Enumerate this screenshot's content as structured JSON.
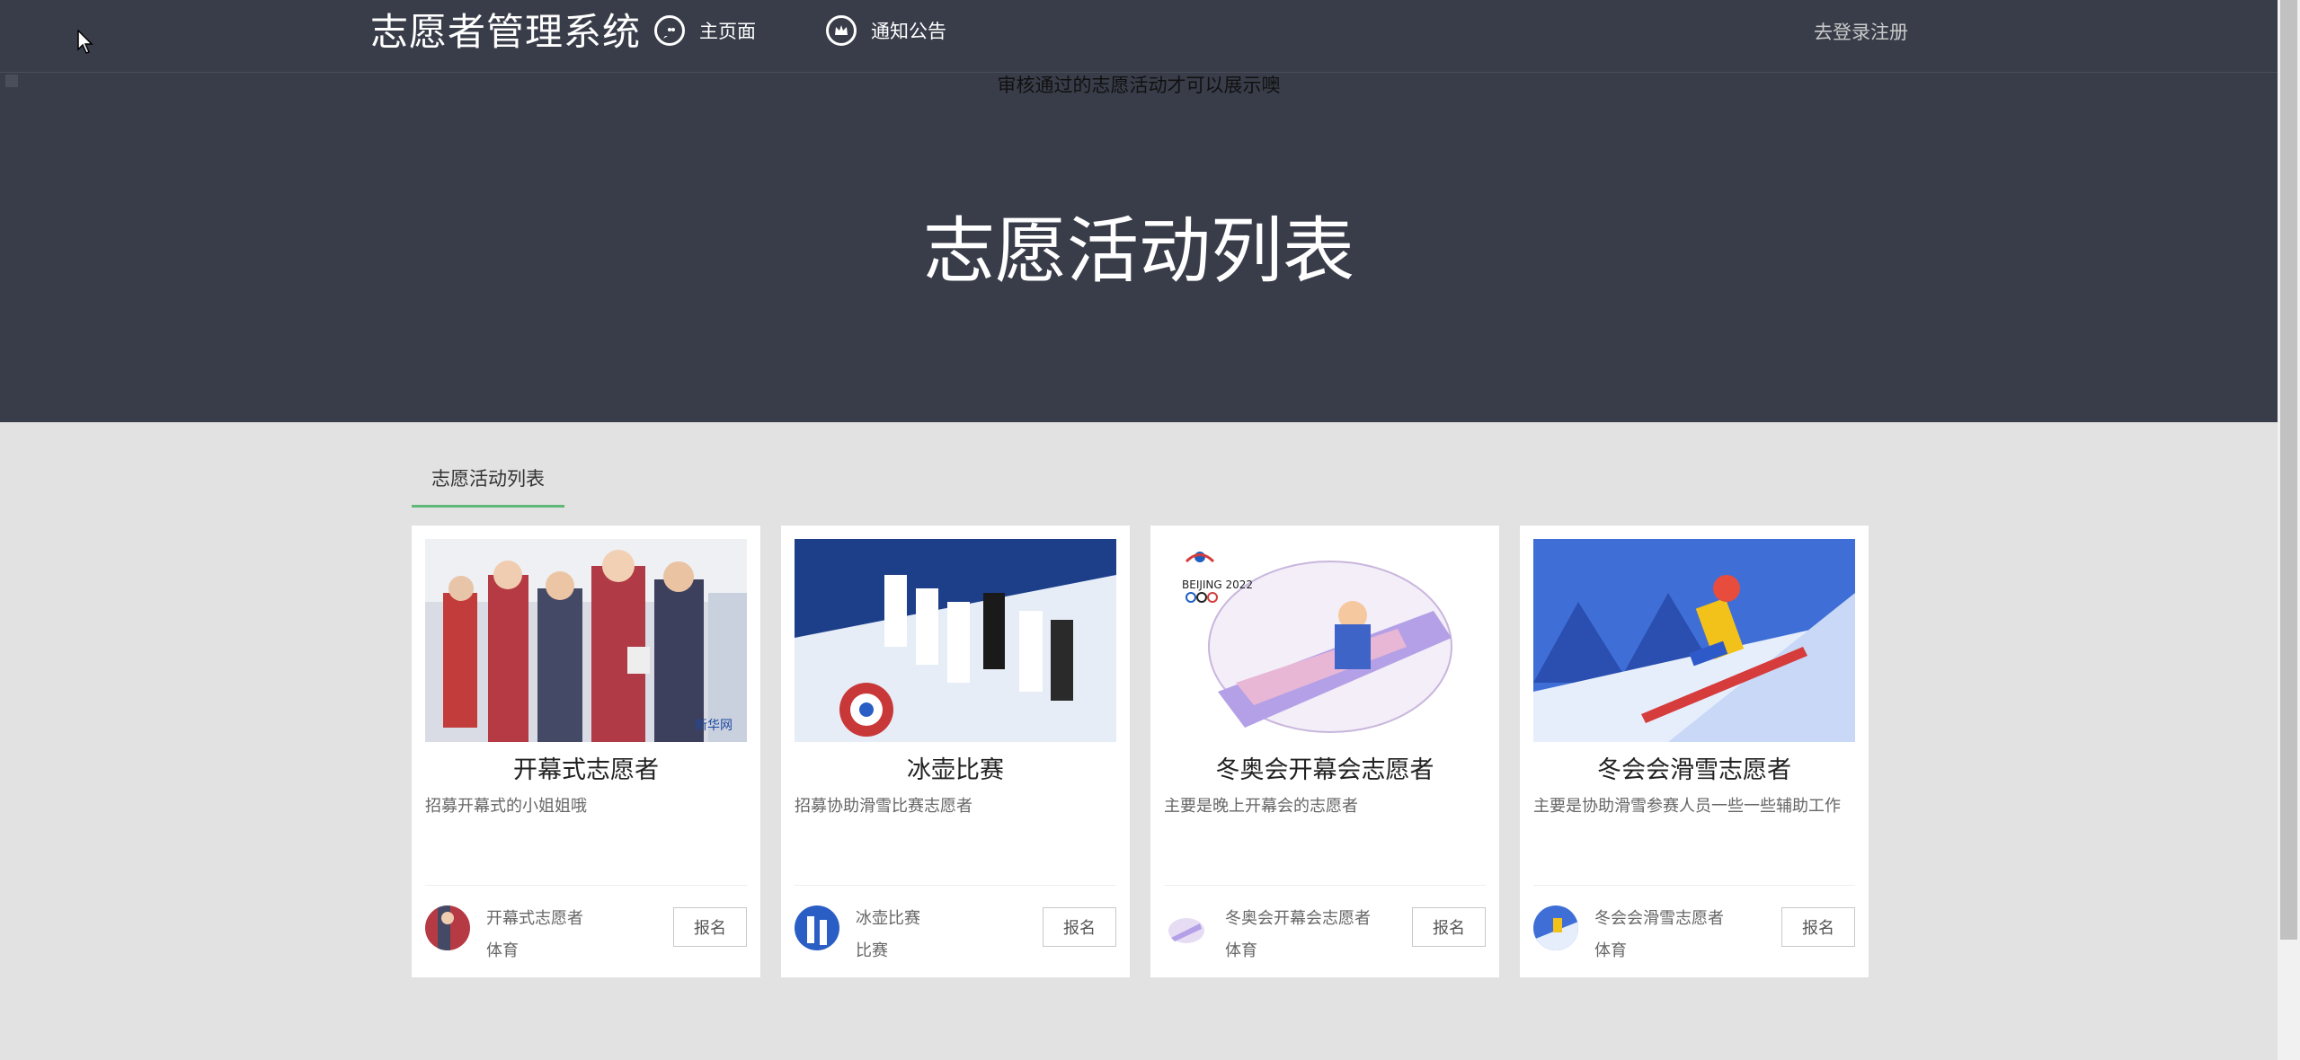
{
  "topbar": {
    "logo": "志愿者管理系统",
    "nav": [
      {
        "label": "主页面",
        "icon": "chat-icon"
      },
      {
        "label": "通知公告",
        "icon": "crown-icon"
      }
    ],
    "login_link": "去登录注册"
  },
  "hero": {
    "tip": "审核通过的志愿活动才可以展示噢",
    "title": "志愿活动列表"
  },
  "tabs": [
    {
      "label": "志愿活动列表"
    }
  ],
  "activities": [
    {
      "title": "开幕式志愿者",
      "desc": "招募开幕式的小姐姐哦",
      "meta_name": "开幕式志愿者",
      "category": "体育",
      "button": "报名"
    },
    {
      "title": "冰壶比赛",
      "desc": "招募协助滑雪比赛志愿者",
      "meta_name": "冰壶比赛",
      "category": "比赛",
      "button": "报名"
    },
    {
      "title": "冬奥会开幕会志愿者",
      "desc": "主要是晚上开幕会的志愿者",
      "meta_name": "冬奥会开幕会志愿者",
      "category": "体育",
      "button": "报名"
    },
    {
      "title": "冬会会滑雪志愿者",
      "desc": "主要是协助滑雪参赛人员一些一些辅助工作",
      "meta_name": "冬会会滑雪志愿者",
      "category": "体育",
      "button": "报名"
    }
  ],
  "colors": {
    "header_bg": "#393d49",
    "page_bg": "#e2e2e2",
    "tab_accent": "#5fb878"
  }
}
